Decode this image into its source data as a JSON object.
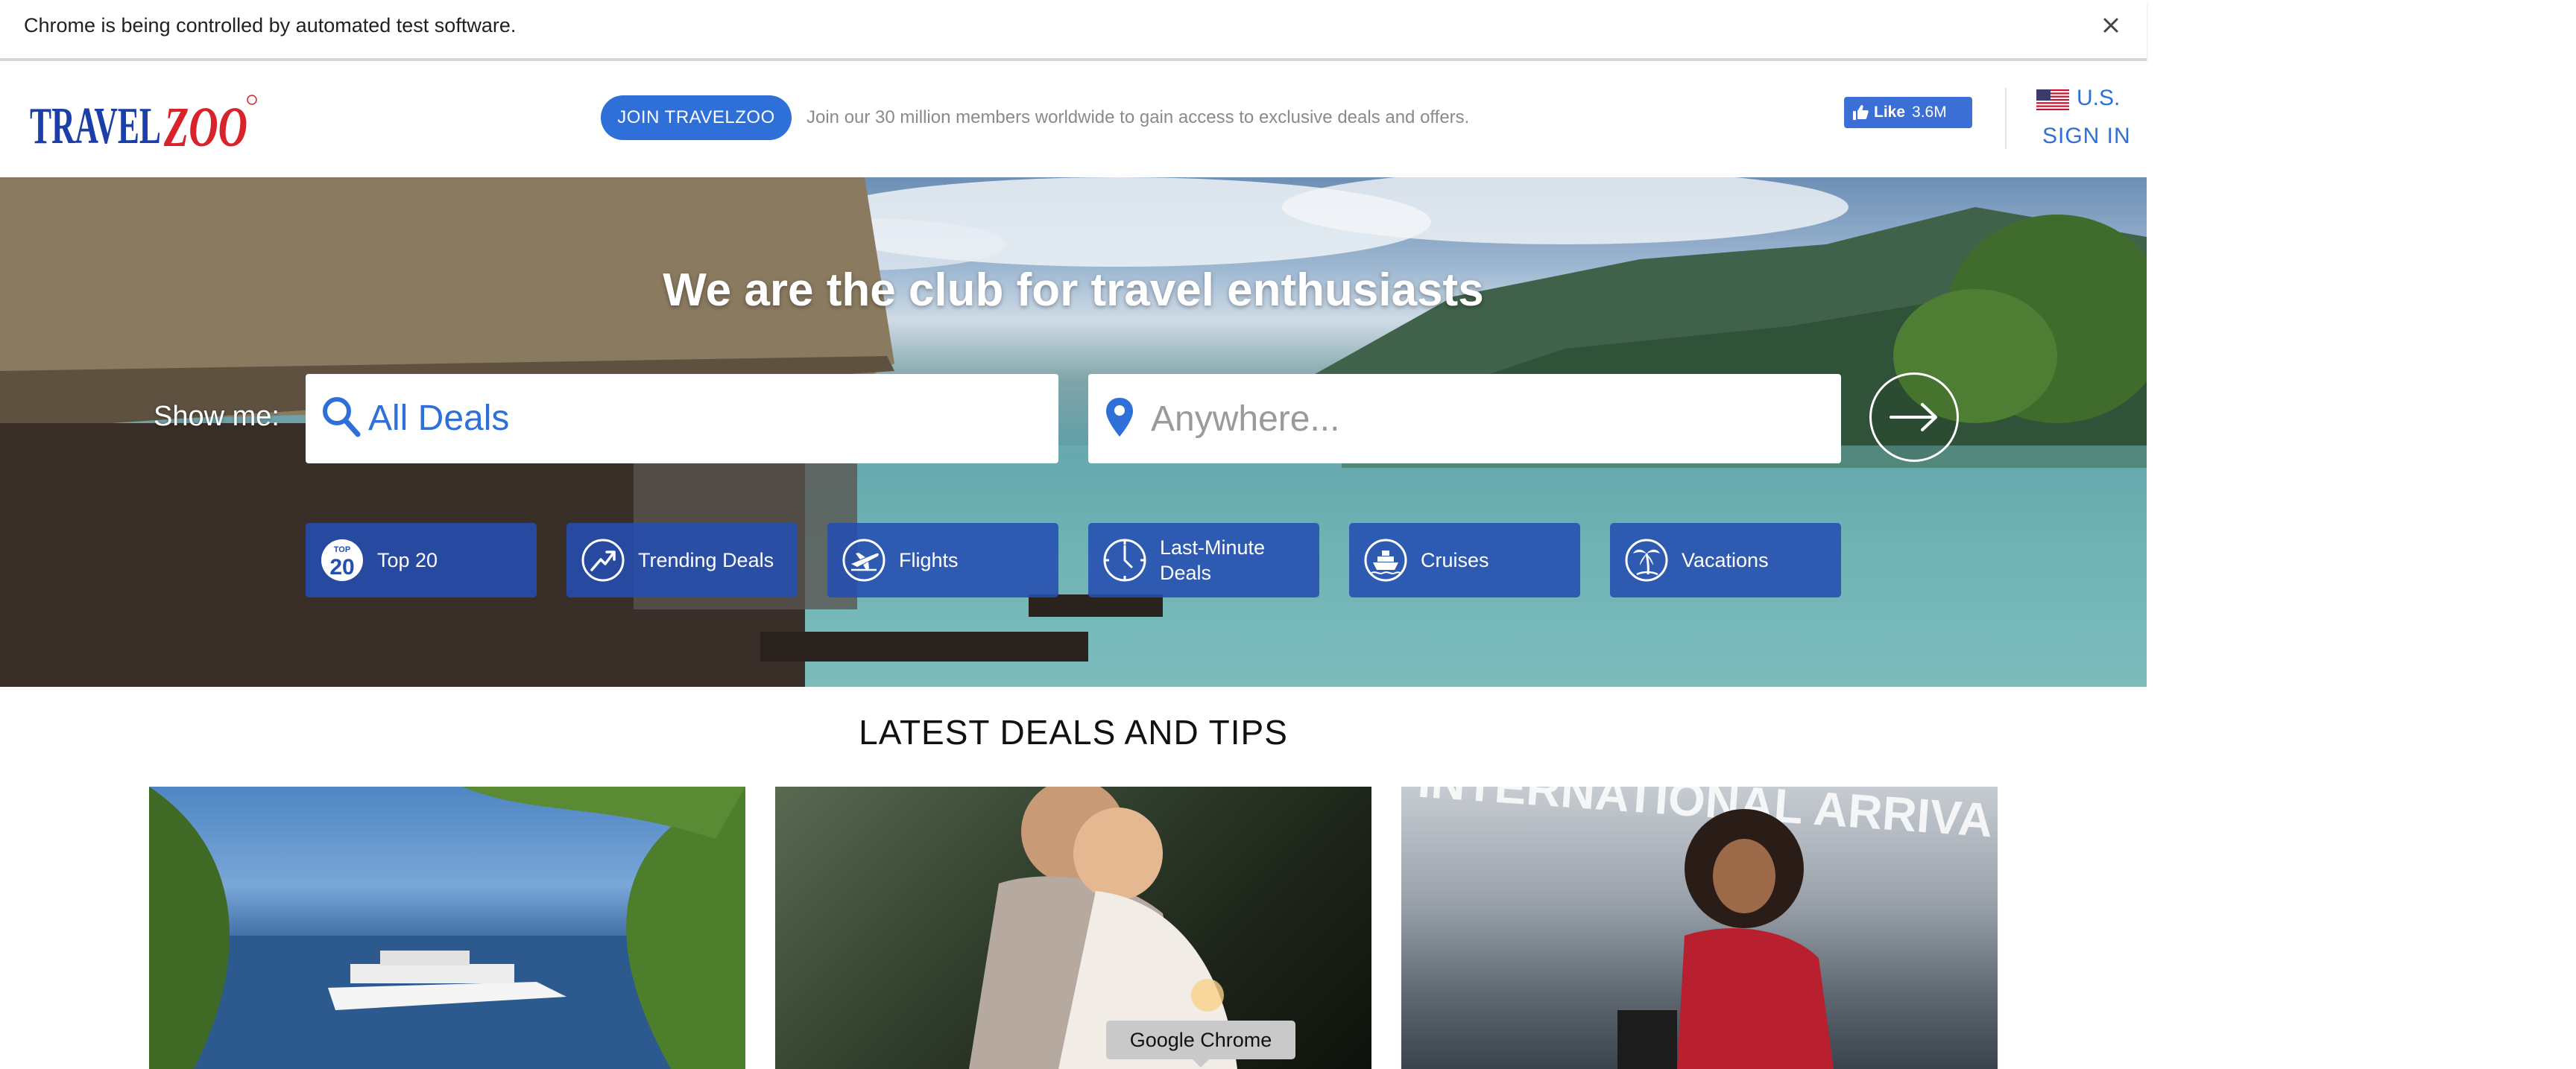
{
  "infobar": {
    "message": "Chrome is being controlled by automated test software."
  },
  "header": {
    "logo_text": "TRAVELZOO",
    "join_button": "JOIN TRAVELZOO",
    "join_text": "Join our 30 million members worldwide to gain access to exclusive deals and offers.",
    "fb_like_label": "Like",
    "fb_like_count": "3.6M",
    "country": "U.S.",
    "sign_in": "SIGN IN"
  },
  "hero": {
    "title": "We are the club for travel enthusiasts",
    "show_me_label": "Show me:",
    "deal_type_value": "All Deals",
    "location_placeholder": "Anywhere...",
    "categories": [
      {
        "label": "Top 20",
        "icon": "top-20-icon"
      },
      {
        "label": "Trending Deals",
        "icon": "trending-icon"
      },
      {
        "label": "Flights",
        "icon": "plane-icon"
      },
      {
        "label": "Last-Minute Deals",
        "icon": "clock-icon"
      },
      {
        "label": "Cruises",
        "icon": "ship-icon"
      },
      {
        "label": "Vacations",
        "icon": "palm-tree-icon"
      }
    ]
  },
  "latest": {
    "title": "LATEST DEALS AND TIPS"
  },
  "tooltip": {
    "text": "Google Chrome"
  },
  "colors": {
    "brand_blue": "#2f6fd8",
    "category_blue": "#244eb0",
    "logo_blue": "#1b3fa8",
    "logo_red": "#d8232a"
  }
}
